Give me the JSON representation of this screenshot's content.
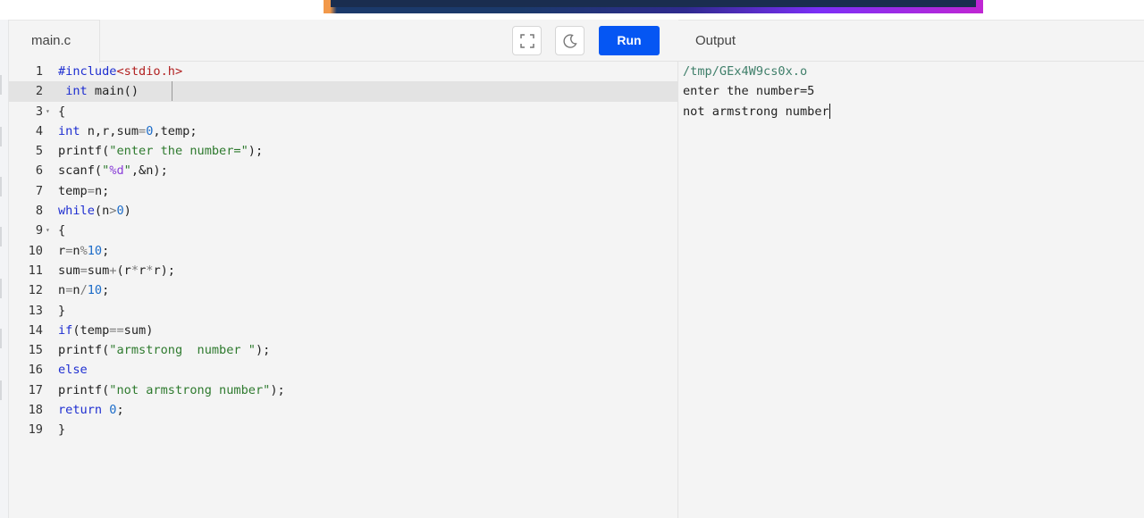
{
  "editor": {
    "file_tab": "main.c",
    "run_label": "Run",
    "fullscreen_icon": "fullscreen-icon",
    "theme_icon": "moon-icon",
    "active_line": 2,
    "lines": [
      {
        "n": "1",
        "fold": "",
        "text": "#include<stdio.h>"
      },
      {
        "n": "2",
        "fold": "",
        "text": " int main()"
      },
      {
        "n": "3",
        "fold": "▾",
        "text": "{"
      },
      {
        "n": "4",
        "fold": "",
        "text": "int n,r,sum=0,temp;"
      },
      {
        "n": "5",
        "fold": "",
        "text": "printf(\"enter the number=\");"
      },
      {
        "n": "6",
        "fold": "",
        "text": "scanf(\"%d\",&n);"
      },
      {
        "n": "7",
        "fold": "",
        "text": "temp=n;"
      },
      {
        "n": "8",
        "fold": "",
        "text": "while(n>0)"
      },
      {
        "n": "9",
        "fold": "▾",
        "text": "{"
      },
      {
        "n": "10",
        "fold": "",
        "text": "r=n%10;"
      },
      {
        "n": "11",
        "fold": "",
        "text": "sum=sum+(r*r*r);"
      },
      {
        "n": "12",
        "fold": "",
        "text": "n=n/10;"
      },
      {
        "n": "13",
        "fold": "",
        "text": "}"
      },
      {
        "n": "14",
        "fold": "",
        "text": "if(temp==sum)"
      },
      {
        "n": "15",
        "fold": "",
        "text": "printf(\"armstrong  number \");"
      },
      {
        "n": "16",
        "fold": "",
        "text": "else"
      },
      {
        "n": "17",
        "fold": "",
        "text": "printf(\"not armstrong number\");"
      },
      {
        "n": "18",
        "fold": "",
        "text": "return 0;"
      },
      {
        "n": "19",
        "fold": "",
        "text": "}"
      }
    ]
  },
  "output": {
    "title": "Output",
    "lines": [
      "/tmp/GEx4W9cs0x.o",
      "enter the number=5",
      "not armstrong number"
    ]
  },
  "colors": {
    "run_button": "#0556f3",
    "keyword": "#1f2fd1",
    "string": "#2e7a2e",
    "include": "#b22222",
    "number": "#1c6cc9"
  }
}
